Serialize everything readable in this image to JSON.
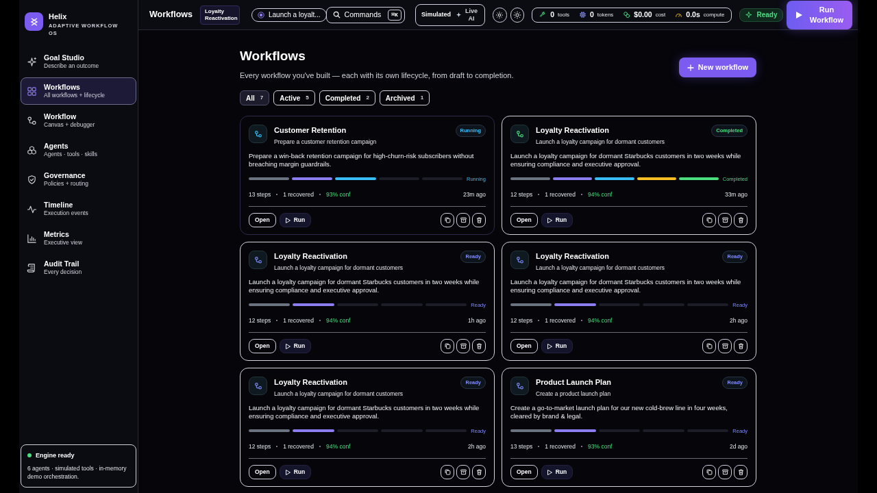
{
  "brand": {
    "name": "Helix",
    "tagline": "ADAPTIVE WORKFLOW OS"
  },
  "sidebar": {
    "items": [
      {
        "title": "Goal Studio",
        "subtitle": "Describe an outcome",
        "selected": false
      },
      {
        "title": "Workflows",
        "subtitle": "All workflows + lifecycle",
        "selected": true
      },
      {
        "title": "Workflow",
        "subtitle": "Canvas + debugger",
        "selected": false
      },
      {
        "title": "Agents",
        "subtitle": "Agents · tools · skills",
        "selected": false
      },
      {
        "title": "Governance",
        "subtitle": "Policies + routing",
        "selected": false
      },
      {
        "title": "Timeline",
        "subtitle": "Execution events",
        "selected": false
      },
      {
        "title": "Metrics",
        "subtitle": "Executive view",
        "selected": false
      },
      {
        "title": "Audit Trail",
        "subtitle": "Every decision",
        "selected": false
      }
    ],
    "engine": {
      "title": "Engine ready",
      "text": "6 agents · simulated tools · in-memory demo orchestration.",
      "color": "#4ade80"
    }
  },
  "topbar": {
    "title": "Workflows",
    "context_badge": "Loyalty Reactivation",
    "goal_pill": "Launch a loyalt...",
    "commands": {
      "label": "Commands",
      "shortcut": "⌘K"
    },
    "mode": [
      {
        "label": "Simulated",
        "selected": true
      },
      {
        "label": "Live AI",
        "selected": false
      }
    ],
    "metrics": [
      {
        "value": "0",
        "label": "tools"
      },
      {
        "value": "0",
        "label": "tokens"
      },
      {
        "value": "$0.00",
        "label": "cost"
      },
      {
        "value": "0.0s",
        "label": "compute"
      }
    ],
    "status": "Ready",
    "run_button": "Run Workflow"
  },
  "header": {
    "title": "Workflows",
    "subtitle": "Every workflow you've built — each with its own lifecycle, from draft to completion.",
    "new_button": "New workflow"
  },
  "filters": [
    {
      "label": "All",
      "count": "7",
      "selected": true
    },
    {
      "label": "Active",
      "count": "5",
      "selected": false
    },
    {
      "label": "Completed",
      "count": "2",
      "selected": false
    },
    {
      "label": "Archived",
      "count": "1",
      "selected": false
    }
  ],
  "cards": [
    {
      "title": "Customer Retention",
      "subtitle": "Prepare a customer retention campaign",
      "status": "Running",
      "color": "#38bdf8",
      "focused": false,
      "description": "Prepare a win-back retention campaign for high-churn-risk subscribers without breaching margin guardrails.",
      "segments": [
        {
          "kind": "filled",
          "color": "#6b7280"
        },
        {
          "kind": "filled",
          "color": "#8b7cf0"
        },
        {
          "kind": "filled",
          "color": "#38bdf8"
        },
        {
          "kind": "empty"
        },
        {
          "kind": "empty"
        }
      ],
      "stage_label": "Running",
      "steps": "13 steps",
      "recovered": "1 recovered",
      "confidence": "93% conf",
      "time": "23m ago",
      "open": "Open",
      "run": "Run"
    },
    {
      "title": "Loyalty Reactivation",
      "subtitle": "Launch a loyalty campaign for dormant customers",
      "status": "Completed",
      "color": "#4ade80",
      "focused": true,
      "description": "Launch a loyalty campaign for dormant Starbucks customers in two weeks while ensuring compliance and executive approval.",
      "segments": [
        {
          "kind": "filled",
          "color": "#6b7280"
        },
        {
          "kind": "filled",
          "color": "#8b7cf0"
        },
        {
          "kind": "filled",
          "color": "#38bdf8"
        },
        {
          "kind": "filled",
          "color": "#fbbf24"
        },
        {
          "kind": "filled",
          "color": "#4ade80"
        }
      ],
      "stage_label": "Completed",
      "steps": "12 steps",
      "recovered": "1 recovered",
      "confidence": "94% conf",
      "time": "33m ago",
      "open": "Open",
      "run": "Run"
    },
    {
      "title": "Loyalty Reactivation",
      "subtitle": "Launch a loyalty campaign for dormant customers",
      "status": "Ready",
      "color": "#818cf8",
      "focused": true,
      "description": "Launch a loyalty campaign for dormant Starbucks customers in two weeks while ensuring compliance and executive approval.",
      "segments": [
        {
          "kind": "filled",
          "color": "#6b7280"
        },
        {
          "kind": "filled",
          "color": "#8b7cf0"
        },
        {
          "kind": "empty"
        },
        {
          "kind": "empty"
        },
        {
          "kind": "empty"
        }
      ],
      "stage_label": "Ready",
      "steps": "12 steps",
      "recovered": "1 recovered",
      "confidence": "94% conf",
      "time": "1h ago",
      "open": "Open",
      "run": "Run"
    },
    {
      "title": "Loyalty Reactivation",
      "subtitle": "Launch a loyalty campaign for dormant customers",
      "status": "Ready",
      "color": "#818cf8",
      "focused": true,
      "description": "Launch a loyalty campaign for dormant Starbucks customers in two weeks while ensuring compliance and executive approval.",
      "segments": [
        {
          "kind": "filled",
          "color": "#6b7280"
        },
        {
          "kind": "filled",
          "color": "#8b7cf0"
        },
        {
          "kind": "empty"
        },
        {
          "kind": "empty"
        },
        {
          "kind": "empty"
        }
      ],
      "stage_label": "Ready",
      "steps": "12 steps",
      "recovered": "1 recovered",
      "confidence": "94% conf",
      "time": "2h ago",
      "open": "Open",
      "run": "Run"
    },
    {
      "title": "Loyalty Reactivation",
      "subtitle": "Launch a loyalty campaign for dormant customers",
      "status": "Ready",
      "color": "#818cf8",
      "focused": true,
      "description": "Launch a loyalty campaign for dormant Starbucks customers in two weeks while ensuring compliance and executive approval.",
      "segments": [
        {
          "kind": "filled",
          "color": "#6b7280"
        },
        {
          "kind": "filled",
          "color": "#8b7cf0"
        },
        {
          "kind": "empty"
        },
        {
          "kind": "empty"
        },
        {
          "kind": "empty"
        }
      ],
      "stage_label": "Ready",
      "steps": "12 steps",
      "recovered": "1 recovered",
      "confidence": "94% conf",
      "time": "2h ago",
      "open": "Open",
      "run": "Run"
    },
    {
      "title": "Product Launch Plan",
      "subtitle": "Create a product launch plan",
      "status": "Ready",
      "color": "#818cf8",
      "focused": true,
      "description": "Create a go-to-market launch plan for our new cold-brew line in four weeks, cleared by brand & legal.",
      "segments": [
        {
          "kind": "filled",
          "color": "#6b7280"
        },
        {
          "kind": "filled",
          "color": "#8b7cf0"
        },
        {
          "kind": "empty"
        },
        {
          "kind": "empty"
        },
        {
          "kind": "empty"
        }
      ],
      "stage_label": "Ready",
      "steps": "13 steps",
      "recovered": "1 recovered",
      "confidence": "93% conf",
      "time": "2d ago",
      "open": "Open",
      "run": "Run"
    }
  ]
}
